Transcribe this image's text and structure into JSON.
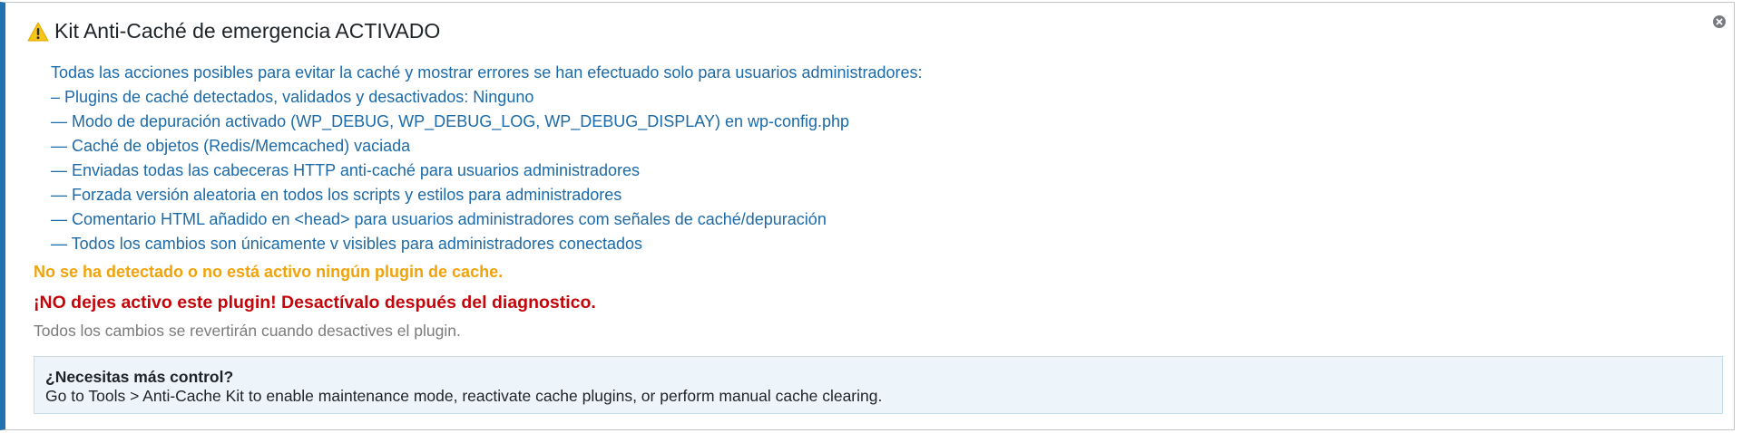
{
  "notice": {
    "title": "Kit Anti-Caché de emergencia ACTIVADO",
    "warning_icon": "warning-icon",
    "dismiss_icon": "dismiss-icon",
    "actions": [
      "Todas las acciones posibles para evitar la caché y mostrar errores se han efectuado solo para usuarios administradores:",
      "– Plugins de caché detectados, validados y desactivados: Ninguno",
      "— Modo de depuración activado (WP_DEBUG, WP_DEBUG_LOG, WP_DEBUG_DISPLAY) en wp-config.php",
      "— Caché de objetos (Redis/Memcached) vaciada",
      "— Enviadas todas las cabeceras HTTP anti-caché para usuarios administradores",
      "— Forzada versión aleatoria en todos los scripts y estilos para administradores",
      "— Comentario HTML añadido en <head> para usuarios administradores com señales de caché/depuración",
      "— Todos los cambios son únicamente v visibles para administradores conectados"
    ],
    "no_cache_plugin_msg": "No se ha detectado o no está activo ningún plugin de cache.",
    "danger_msg": "¡NO dejes activo este plugin! Desactívalo después del diagnostico.",
    "revert_msg": "Todos los cambios se revertirán cuando desactives el plugin."
  },
  "info_box": {
    "title": "¿Necesitas más control?",
    "text": "Go to Tools > Anti-Cache Kit to enable maintenance mode, reactivate cache plugins, or perform manual cache clearing."
  },
  "colors": {
    "accent_border": "#2271b1",
    "action_text": "#1c6aa8",
    "warning_text": "#f0a30a",
    "danger_text": "#c4050a",
    "muted_text": "#7b7b7b",
    "info_bg": "#eef5fa"
  }
}
